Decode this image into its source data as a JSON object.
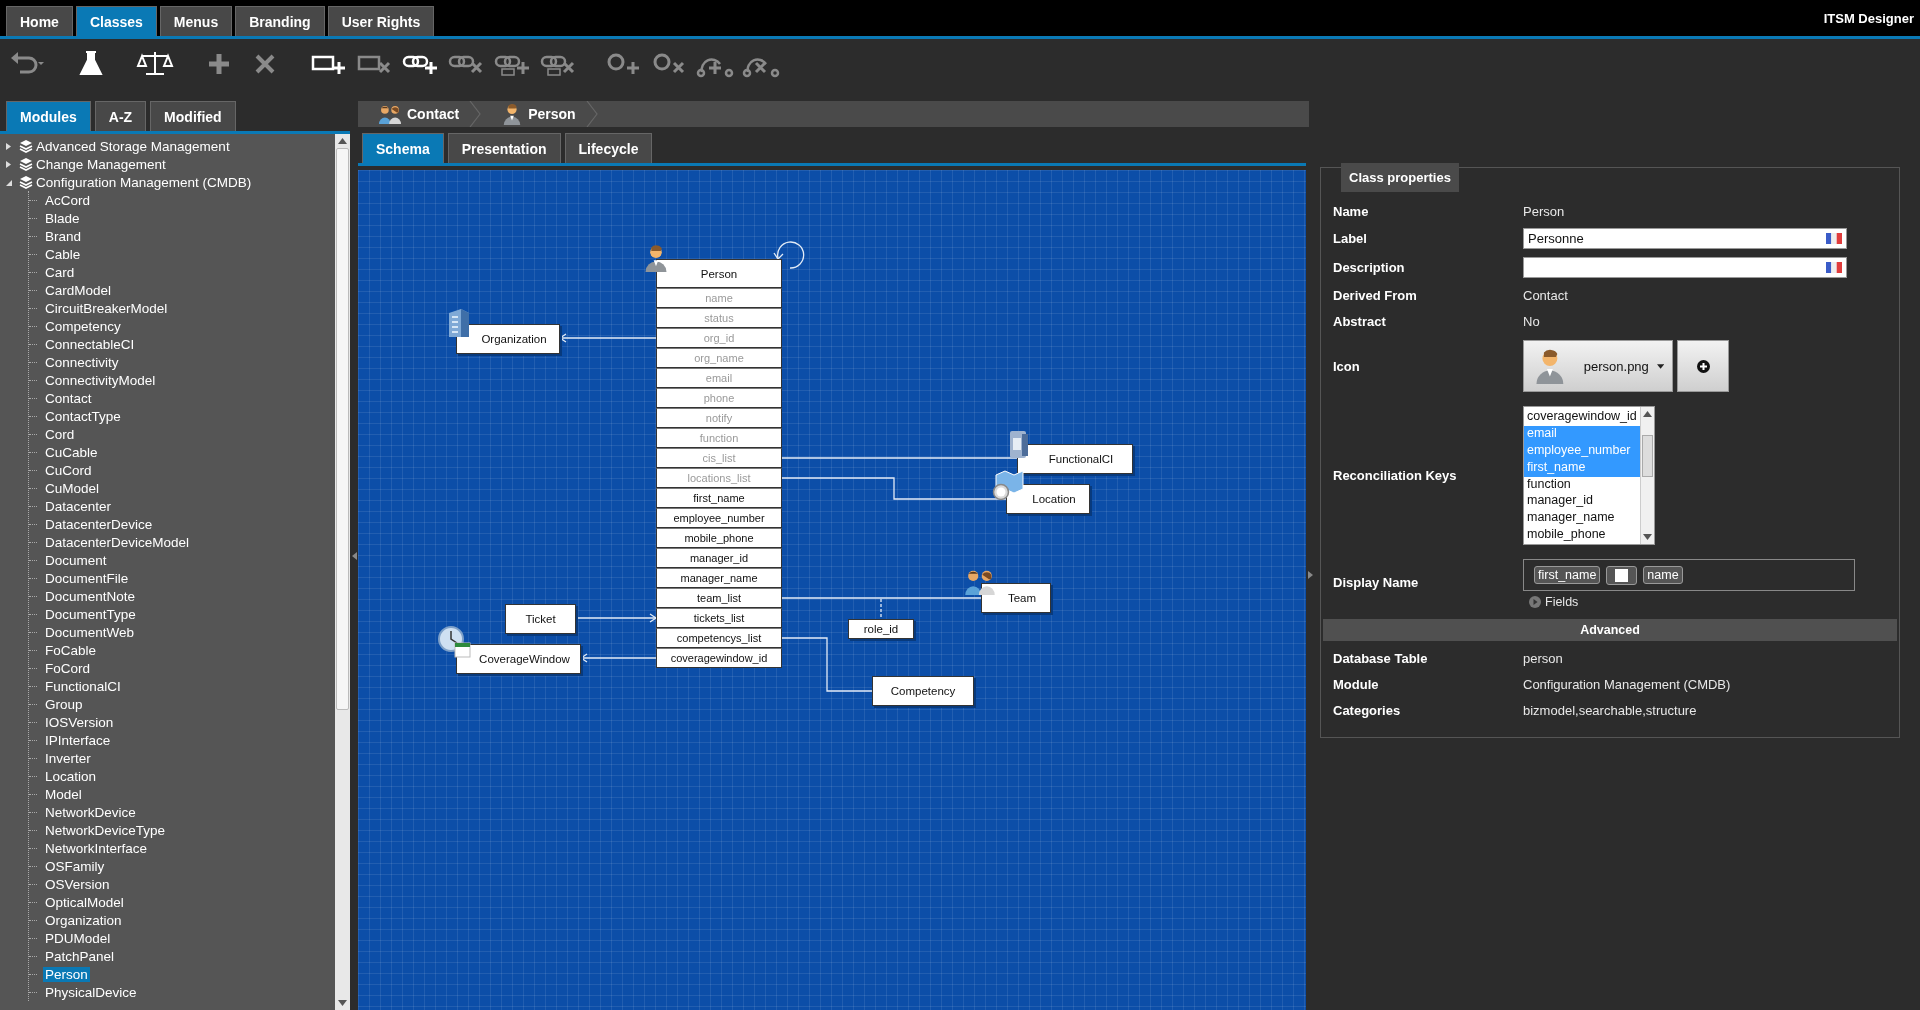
{
  "menu_tabs": [
    {
      "label": "Home",
      "selected": false
    },
    {
      "label": "Classes",
      "selected": true
    },
    {
      "label": "Menus",
      "selected": false
    },
    {
      "label": "Branding",
      "selected": false
    },
    {
      "label": "User Rights",
      "selected": false
    }
  ],
  "app_title": "ITSM Designer",
  "toolbar": [
    [
      {
        "kind": "undo",
        "disabled": true
      }
    ],
    [
      {
        "kind": "flask",
        "disabled": false
      }
    ],
    [
      {
        "kind": "compare",
        "disabled": false
      }
    ],
    [
      {
        "kind": "add",
        "disabled": true
      },
      {
        "kind": "delete",
        "disabled": true
      }
    ],
    [
      {
        "kind": "add-attribute",
        "disabled": false
      },
      {
        "kind": "delete-attribute",
        "disabled": true
      },
      {
        "kind": "add-link",
        "disabled": false
      },
      {
        "kind": "delete-link",
        "disabled": true
      },
      {
        "kind": "add-link-attribute",
        "disabled": true
      },
      {
        "kind": "delete-link-attribute",
        "disabled": true
      }
    ],
    [
      {
        "kind": "add-state",
        "disabled": true
      },
      {
        "kind": "delete-state",
        "disabled": true
      },
      {
        "kind": "add-transition",
        "disabled": true
      },
      {
        "kind": "delete-transition",
        "disabled": true
      }
    ]
  ],
  "left_tabs": [
    {
      "label": "Modules",
      "selected": true
    },
    {
      "label": "A-Z",
      "selected": false
    },
    {
      "label": "Modified",
      "selected": false
    }
  ],
  "tree": [
    {
      "label": "Advanced Storage Management",
      "expanded": false,
      "selected": false
    },
    {
      "label": "Change Management",
      "expanded": false,
      "selected": false
    },
    {
      "label": "Configuration Management (CMDB)",
      "expanded": true,
      "selected": false,
      "children": [
        {
          "label": "AcCord",
          "selected": false
        },
        {
          "label": "Blade",
          "selected": false
        },
        {
          "label": "Brand",
          "selected": false
        },
        {
          "label": "Cable",
          "selected": false
        },
        {
          "label": "Card",
          "selected": false
        },
        {
          "label": "CardModel",
          "selected": false
        },
        {
          "label": "CircuitBreakerModel",
          "selected": false
        },
        {
          "label": "Competency",
          "selected": false
        },
        {
          "label": "ConnectableCI",
          "selected": false
        },
        {
          "label": "Connectivity",
          "selected": false
        },
        {
          "label": "ConnectivityModel",
          "selected": false
        },
        {
          "label": "Contact",
          "selected": false
        },
        {
          "label": "ContactType",
          "selected": false
        },
        {
          "label": "Cord",
          "selected": false
        },
        {
          "label": "CuCable",
          "selected": false
        },
        {
          "label": "CuCord",
          "selected": false
        },
        {
          "label": "CuModel",
          "selected": false
        },
        {
          "label": "Datacenter",
          "selected": false
        },
        {
          "label": "DatacenterDevice",
          "selected": false
        },
        {
          "label": "DatacenterDeviceModel",
          "selected": false
        },
        {
          "label": "Document",
          "selected": false
        },
        {
          "label": "DocumentFile",
          "selected": false
        },
        {
          "label": "DocumentNote",
          "selected": false
        },
        {
          "label": "DocumentType",
          "selected": false
        },
        {
          "label": "DocumentWeb",
          "selected": false
        },
        {
          "label": "FoCable",
          "selected": false
        },
        {
          "label": "FoCord",
          "selected": false
        },
        {
          "label": "FunctionalCI",
          "selected": false
        },
        {
          "label": "Group",
          "selected": false
        },
        {
          "label": "IOSVersion",
          "selected": false
        },
        {
          "label": "IPInterface",
          "selected": false
        },
        {
          "label": "Inverter",
          "selected": false
        },
        {
          "label": "Location",
          "selected": false
        },
        {
          "label": "Model",
          "selected": false
        },
        {
          "label": "NetworkDevice",
          "selected": false
        },
        {
          "label": "NetworkDeviceType",
          "selected": false
        },
        {
          "label": "NetworkInterface",
          "selected": false
        },
        {
          "label": "OSFamily",
          "selected": false
        },
        {
          "label": "OSVersion",
          "selected": false
        },
        {
          "label": "OpticalModel",
          "selected": false
        },
        {
          "label": "Organization",
          "selected": false
        },
        {
          "label": "PDUModel",
          "selected": false
        },
        {
          "label": "PatchPanel",
          "selected": false
        },
        {
          "label": "Person",
          "selected": true
        },
        {
          "label": "PhysicalDevice",
          "selected": false
        }
      ]
    }
  ],
  "breadcrumb": [
    {
      "label": "Contact",
      "kind": "people"
    },
    {
      "label": "Person",
      "kind": "person"
    }
  ],
  "view_tabs": [
    {
      "label": "Schema",
      "selected": true
    },
    {
      "label": "Presentation",
      "selected": false
    },
    {
      "label": "Lifecycle",
      "selected": false
    }
  ],
  "diagram": {
    "class": {
      "name": "Person",
      "kind": "person",
      "attributes": [
        {
          "name": "name",
          "inherited": true
        },
        {
          "name": "status",
          "inherited": true
        },
        {
          "name": "org_id",
          "inherited": true
        },
        {
          "name": "org_name",
          "inherited": true
        },
        {
          "name": "email",
          "inherited": true
        },
        {
          "name": "phone",
          "inherited": true
        },
        {
          "name": "notify",
          "inherited": true
        },
        {
          "name": "function",
          "inherited": true
        },
        {
          "name": "cis_list",
          "inherited": true
        },
        {
          "name": "locations_list",
          "inherited": true
        },
        {
          "name": "first_name",
          "inherited": false
        },
        {
          "name": "employee_number",
          "inherited": false
        },
        {
          "name": "mobile_phone",
          "inherited": false
        },
        {
          "name": "manager_id",
          "inherited": false
        },
        {
          "name": "manager_name",
          "inherited": false
        },
        {
          "name": "team_list",
          "inherited": false
        },
        {
          "name": "tickets_list",
          "inherited": false
        },
        {
          "name": "competencys_list",
          "inherited": false
        },
        {
          "name": "coveragewindow_id",
          "inherited": false
        }
      ]
    },
    "related": [
      {
        "label": "Organization",
        "kind": "building"
      },
      {
        "label": "FunctionalCI",
        "kind": "server"
      },
      {
        "label": "Location",
        "kind": "map"
      },
      {
        "label": "Team",
        "kind": "people"
      },
      {
        "label": "Ticket",
        "kind": "plain"
      },
      {
        "label": "CoverageWindow",
        "kind": "clock"
      },
      {
        "label": "Competency",
        "kind": "plain"
      },
      {
        "label": "role_id",
        "kind": "attribute"
      }
    ]
  },
  "properties": {
    "title": "Class properties",
    "name": {
      "label": "Name",
      "value": "Person"
    },
    "label": {
      "label": "Label",
      "value": "Personne"
    },
    "description": {
      "label": "Description"
    },
    "derived_from": {
      "label": "Derived From",
      "value": "Contact"
    },
    "abstract": {
      "label": "Abstract",
      "value": "No"
    },
    "icon": {
      "label": "Icon",
      "value": "person.png"
    },
    "reconciliation_keys": {
      "label": "Reconciliation Keys",
      "options": [
        {
          "label": "coveragewindow_id",
          "selected": false
        },
        {
          "label": "email",
          "selected": true
        },
        {
          "label": "employee_number",
          "selected": true
        },
        {
          "label": "first_name",
          "selected": true
        },
        {
          "label": "function",
          "selected": false
        },
        {
          "label": "manager_id",
          "selected": false
        },
        {
          "label": "manager_name",
          "selected": false
        },
        {
          "label": "mobile_phone",
          "selected": false
        }
      ]
    },
    "display_name": {
      "label": "Display Name",
      "tokens": [
        {
          "kind": "field",
          "text": "first_name"
        },
        {
          "kind": "space"
        },
        {
          "kind": "field",
          "text": "name"
        }
      ],
      "fields_toggle": "Fields"
    },
    "advanced_title": "Advanced",
    "advanced": [
      {
        "label": "Database Table",
        "value": "person"
      },
      {
        "label": "Module",
        "value": "Configuration Management (CMDB)"
      },
      {
        "label": "Categories",
        "value": "bizmodel,searchable,structure"
      }
    ]
  }
}
